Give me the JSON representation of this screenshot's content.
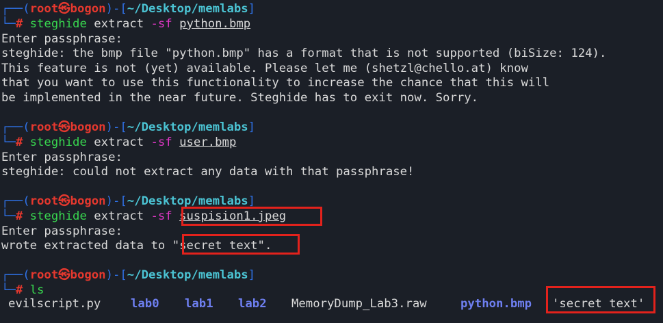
{
  "prompt": {
    "corner_top": "┌──(",
    "user": "root",
    "at_symbol": "㉿",
    "host": "bogon",
    "close_paren": ")-[",
    "path": "~/Desktop/memlabs",
    "close_bracket": "]",
    "corner_bottom": "└─",
    "hash": "#"
  },
  "commands": [
    {
      "cmd": "steghide",
      "sub": " extract ",
      "flag": "-sf",
      "file": "python.bmp"
    },
    {
      "cmd": "steghide",
      "sub": " extract ",
      "flag": "-sf",
      "file": "user.bmp"
    },
    {
      "cmd": "steghide",
      "sub": " extract ",
      "flag": "-sf",
      "file": "suspision1.jpeg"
    },
    {
      "cmd": "ls"
    }
  ],
  "output": {
    "block1": [
      "Enter passphrase:",
      "steghide: the bmp file \"python.bmp\" has a format that is not supported (biSize: 124).",
      "This feature is not (yet) available. Please let me (shetzl@chello.at) know",
      "that you want to use this functionality to increase the chance that this will",
      "be implemented in the near future. Steghide has to exit now. Sorry."
    ],
    "block2": [
      "Enter passphrase:",
      "steghide: could not extract any data with that passphrase!"
    ],
    "block3": [
      "Enter passphrase:",
      "wrote extracted data to ",
      "\"secret text\".",
      ""
    ]
  },
  "ls_listing": [
    {
      "name": "evilscript.py",
      "kind": "file"
    },
    {
      "name": "lab0",
      "kind": "dir"
    },
    {
      "name": "lab1",
      "kind": "dir"
    },
    {
      "name": "lab2",
      "kind": "dir"
    },
    {
      "name": "MemoryDump_Lab3.raw",
      "kind": "file"
    },
    {
      "name": "python.bmp",
      "kind": "dir"
    },
    {
      "name": "'secret text'",
      "kind": "file"
    }
  ],
  "colors": {
    "background": "#1b1f27",
    "text": "#d9d9d9",
    "prompt_frame": "#2f72e8",
    "root_user": "#e5382e",
    "path": "#4bc3d3",
    "command": "#38d64f",
    "flag": "#dd37c4",
    "directory": "#6e7ff0",
    "highlight_box": "#e3221c"
  }
}
